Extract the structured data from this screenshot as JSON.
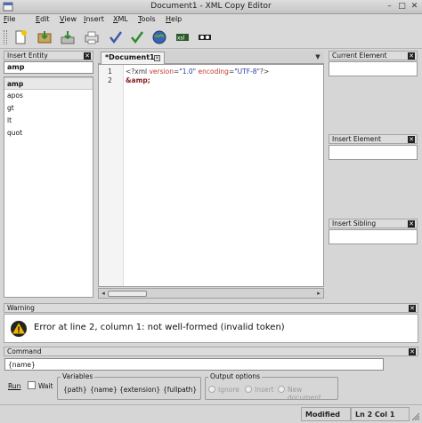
{
  "window": {
    "title": "Document1 - XML Copy Editor"
  },
  "menubar": [
    {
      "label": "File",
      "accel": "F"
    },
    {
      "label": "Edit",
      "accel": "E"
    },
    {
      "label": "View",
      "accel": "V"
    },
    {
      "label": "Insert",
      "accel": "I"
    },
    {
      "label": "XML",
      "accel": "X"
    },
    {
      "label": "Tools",
      "accel": "T"
    },
    {
      "label": "Help",
      "accel": "H"
    }
  ],
  "toolbar": {
    "icons": [
      "new-document-icon",
      "open-icon",
      "save-icon",
      "print-icon",
      "check-wellformed-icon",
      "validate-icon",
      "browser-icon",
      "xslt-icon",
      "xpath-icon"
    ]
  },
  "insert_entity": {
    "title": "Insert Entity",
    "search_value": "amp",
    "items": [
      "amp",
      "apos",
      "gt",
      "lt",
      "quot"
    ],
    "selected": "amp"
  },
  "document_tab": {
    "label": "*Document1"
  },
  "editor": {
    "line_numbers": [
      "1",
      "2"
    ],
    "line1": {
      "open": "<?xml",
      "attr1": "version",
      "eq1": "=",
      "val1": "\"1.0\"",
      "attr2": "encoding",
      "eq2": "=",
      "val2": "\"UTF-8\"",
      "close": "?>"
    },
    "line2": "&amp;"
  },
  "side_panels": {
    "current_element": "Current Element",
    "insert_element": "Insert Element",
    "insert_sibling": "Insert Sibling"
  },
  "warning": {
    "title": "Warning",
    "message": "Error at line 2, column 1: not well-formed (invalid token)"
  },
  "command": {
    "title": "Command",
    "input_value": "{name}",
    "run_label": "Run",
    "wait_label": "Wait",
    "variables_label": "Variables",
    "variables": [
      "{path}",
      "{name}",
      "{extension}",
      "{fullpath}"
    ],
    "output_label": "Output options",
    "output_options": [
      "Ignore",
      "Insert",
      "New document"
    ]
  },
  "status": {
    "modified": "Modified",
    "position": "Ln 2 Col 1"
  },
  "colors": {
    "error_icon": "#f2b400",
    "attr": "#c0392b",
    "value": "#2a3aa8"
  }
}
